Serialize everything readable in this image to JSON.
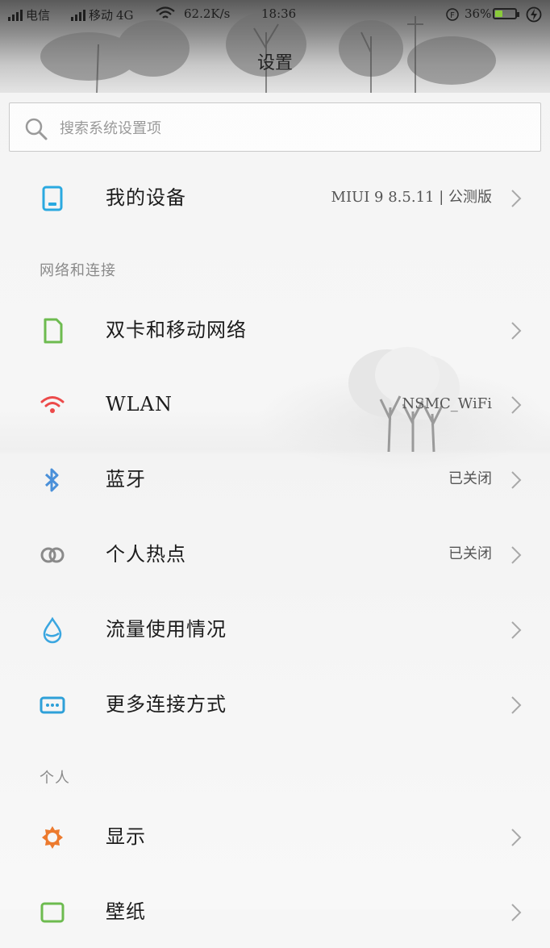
{
  "status_bar": {
    "carrier1": "电信",
    "carrier2": "移动",
    "network_type": "4G",
    "net_speed": "62.2K/s",
    "time": "18:36",
    "battery_percent": "36%",
    "battery_level": 0.36
  },
  "header": {
    "title": "设置"
  },
  "search": {
    "placeholder": "搜索系统设置项"
  },
  "items": {
    "my_device": {
      "label": "我的设备",
      "value": "MIUI 9 8.5.11 | 公测版",
      "icon": "phone-icon",
      "color": "#2aa9e0"
    },
    "sim": {
      "label": "双卡和移动网络",
      "icon": "sim-card-icon",
      "color": "#6dbb4f"
    },
    "wlan": {
      "label": "WLAN",
      "value": "NSMC_WiFi",
      "icon": "wifi-icon",
      "color": "#ec4a4a"
    },
    "bluetooth": {
      "label": "蓝牙",
      "value": "已关闭",
      "icon": "bluetooth-icon",
      "color": "#4a90d9"
    },
    "hotspot": {
      "label": "个人热点",
      "value": "已关闭",
      "icon": "hotspot-icon",
      "color": "#8a8a8a"
    },
    "data_usage": {
      "label": "流量使用情况",
      "icon": "water-drop-icon",
      "color": "#3aa6e0"
    },
    "more_connections": {
      "label": "更多连接方式",
      "icon": "more-connections-icon",
      "color": "#2ea0d8"
    },
    "display": {
      "label": "显示",
      "icon": "sun-icon",
      "color": "#ec7a2e"
    },
    "wallpaper": {
      "label": "壁纸",
      "icon": "wallpaper-icon",
      "color": "#6dbb4f"
    }
  },
  "sections": {
    "network": "网络和连接",
    "personal": "个人"
  }
}
